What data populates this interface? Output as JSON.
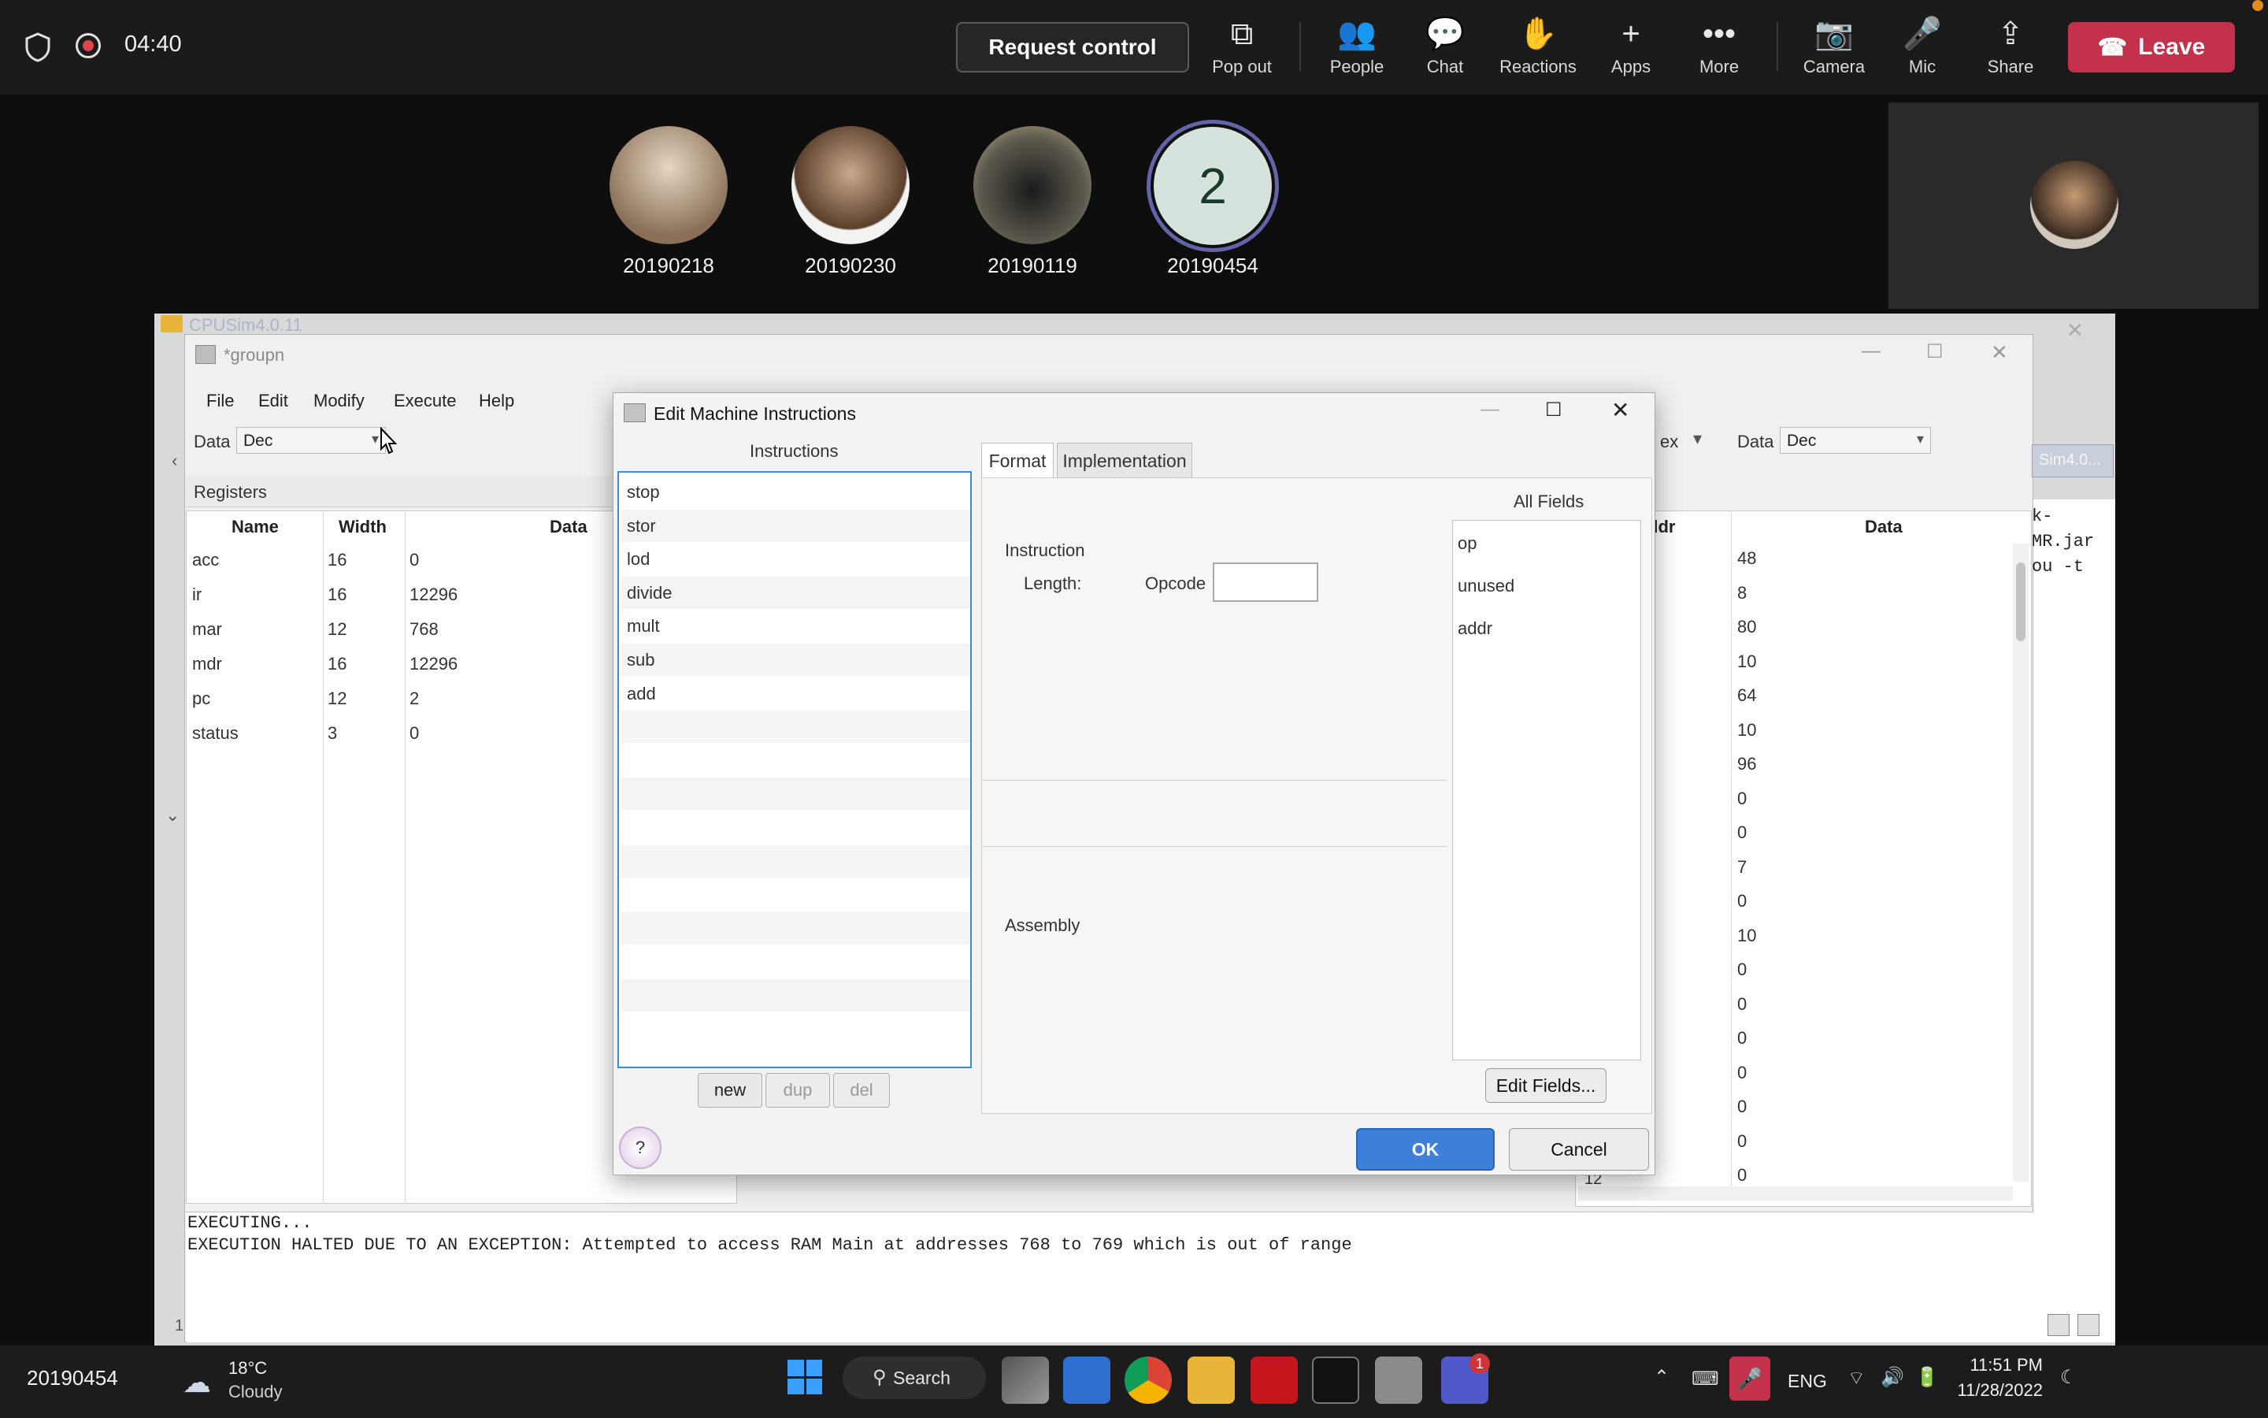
{
  "teams": {
    "timer": "04:40",
    "request_control": "Request control",
    "toolbar": [
      {
        "icon": "pop-out-icon",
        "glyph": "⧉",
        "label": "Pop out"
      },
      {
        "icon": "people-icon",
        "glyph": "👥",
        "label": "People"
      },
      {
        "icon": "chat-icon",
        "glyph": "💬",
        "label": "Chat"
      },
      {
        "icon": "reactions-icon",
        "glyph": "✋",
        "label": "Reactions"
      },
      {
        "icon": "apps-icon",
        "glyph": "+",
        "label": "Apps"
      },
      {
        "icon": "more-icon",
        "glyph": "•••",
        "label": "More"
      },
      {
        "icon": "camera-off-icon",
        "glyph": "📷",
        "label": "Camera"
      },
      {
        "icon": "mic-icon",
        "glyph": "🎤",
        "label": "Mic"
      },
      {
        "icon": "share-icon",
        "glyph": "⇪",
        "label": "Share"
      }
    ],
    "leave_label": "Leave",
    "participants": [
      {
        "name": "20190218"
      },
      {
        "name": "20190230"
      },
      {
        "name": "20190119"
      },
      {
        "name": "20190454",
        "avatar_text": "2"
      }
    ]
  },
  "desktop": {
    "folder_title": "CPUSim4.0.11",
    "outer_title": "*groupn",
    "menu": [
      "File",
      "Edit",
      "Modify",
      "Execute",
      "Help"
    ],
    "data_label": "Data",
    "data_format": "Dec",
    "right_data_label": "Data",
    "right_data_format": "Dec",
    "right_partial_combo": "ex",
    "registers_title": "Registers",
    "register_headers": [
      "Name",
      "Width",
      "Data",
      "Data"
    ],
    "registers": [
      {
        "name": "acc",
        "width": "16",
        "data": "0"
      },
      {
        "name": "ir",
        "width": "16",
        "data": "12296"
      },
      {
        "name": "mar",
        "width": "12",
        "data": "768"
      },
      {
        "name": "mdr",
        "width": "16",
        "data": "12296"
      },
      {
        "name": "pc",
        "width": "12",
        "data": "2"
      },
      {
        "name": "status",
        "width": "3",
        "data": "0"
      }
    ],
    "ram_headers": [
      "ddr",
      "Data"
    ],
    "ram_values": [
      "48",
      "8",
      "80",
      "10",
      "64",
      "10",
      "96",
      "0",
      "0",
      "7",
      "0",
      "10",
      "0",
      "0",
      "0",
      "0",
      "0",
      "0",
      "0"
    ],
    "ram_partial_addr": "12",
    "side_tab": "Sim4.0...",
    "terminal_lines": [
      "k-",
      "MR.jar",
      "",
      "ou -t"
    ],
    "console_lines": [
      "EXECUTING...",
      "EXECUTION HALTED DUE TO AN EXCEPTION: Attempted to access RAM Main at addresses 768 to 769 which is out of range"
    ],
    "left_edge_digit": "1"
  },
  "dialog": {
    "title": "Edit Machine Instructions",
    "instructions_header": "Instructions",
    "instructions": [
      "stop",
      "stor",
      "lod",
      "divide",
      "mult",
      "sub",
      "add"
    ],
    "new_label": "new",
    "dup_label": "dup",
    "del_label": "del",
    "tabs": [
      "Format",
      "Implementation"
    ],
    "instruction_label": "Instruction",
    "length_label": "Length:",
    "opcode_label": "Opcode",
    "opcode_value": "",
    "assembly_label": "Assembly",
    "all_fields_header": "All Fields",
    "fields": [
      "op",
      "unused",
      "addr"
    ],
    "edit_fields_label": "Edit Fields...",
    "help_label": "?",
    "ok_label": "OK",
    "cancel_label": "Cancel"
  },
  "taskbar": {
    "user_id": "20190454",
    "weather_temp": "18°C",
    "weather_desc": "Cloudy",
    "search_label": "Search",
    "lang": "ENG",
    "time": "11:51 PM",
    "date": "11/28/2022",
    "teams_badge": "1"
  },
  "colors": {
    "leave": "#c4314b",
    "accent": "#3d7fd9",
    "avatar_ring": "#6264a7"
  }
}
